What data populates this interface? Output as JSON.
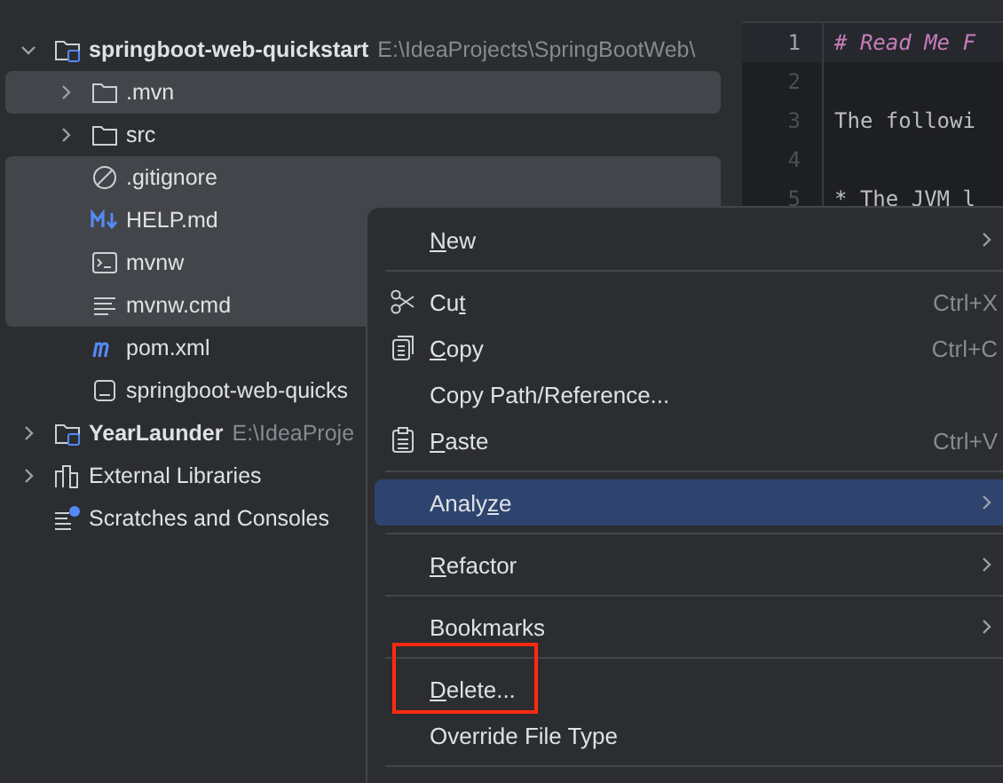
{
  "project_tree": [
    {
      "name": "springboot-web-quickstart",
      "path": "E:\\IdeaProjects\\SpringBootWeb\\",
      "kind": "module",
      "expanded": true,
      "selected": false,
      "children": [
        {
          "name": ".mvn",
          "kind": "folder",
          "expanded": false,
          "selected": true
        },
        {
          "name": "src",
          "kind": "folder",
          "expanded": false,
          "selected": false
        },
        {
          "name": ".gitignore",
          "kind": "ignore",
          "selected": true
        },
        {
          "name": "HELP.md",
          "kind": "markdown",
          "selected": true
        },
        {
          "name": "mvnw",
          "kind": "terminal",
          "selected": true
        },
        {
          "name": "mvnw.cmd",
          "kind": "text",
          "selected": true
        },
        {
          "name": "pom.xml",
          "kind": "maven",
          "selected": false
        },
        {
          "name": "springboot-web-quicks",
          "kind": "file",
          "selected": false
        }
      ]
    },
    {
      "name": "YearLaunder",
      "path": "E:\\IdeaProje",
      "kind": "module",
      "expanded": false,
      "selected": false
    },
    {
      "name": "External Libraries",
      "kind": "library",
      "expanded": false,
      "selected": false
    },
    {
      "name": "Scratches and Consoles",
      "kind": "scratches",
      "selected": false
    }
  ],
  "editor": {
    "lines": [
      {
        "number": "1",
        "text": "# Read Me F",
        "kind": "heading",
        "current": true
      },
      {
        "number": "2",
        "current": false
      },
      {
        "number": "3",
        "text": "The followi",
        "kind": "plain",
        "current": false
      },
      {
        "number": "4",
        "current": false
      },
      {
        "number": "5",
        "text": "* The JVM l",
        "kind": "bullet",
        "current": false
      }
    ]
  },
  "context_menu": {
    "items": [
      {
        "kind": "item",
        "label": {
          "key": "N",
          "after": "ew"
        },
        "submenu": true,
        "selected": false
      },
      {
        "kind": "separator"
      },
      {
        "kind": "cut",
        "label": {
          "before": "Cu",
          "key": "t"
        },
        "shortcut": "Ctrl+X",
        "selected": false
      },
      {
        "kind": "copy",
        "label": {
          "key": "C",
          "after": "opy"
        },
        "shortcut": "Ctrl+C",
        "selected": false
      },
      {
        "kind": "item",
        "label": {
          "before": "Copy Path/Reference..."
        },
        "selected": false
      },
      {
        "kind": "paste",
        "label": {
          "key": "P",
          "after": "aste"
        },
        "shortcut": "Ctrl+V",
        "selected": false
      },
      {
        "kind": "separator"
      },
      {
        "kind": "item",
        "label": {
          "before": "Analy",
          "key": "z",
          "after": "e"
        },
        "submenu": true,
        "selected": true
      },
      {
        "kind": "separator"
      },
      {
        "kind": "item",
        "label": {
          "key": "R",
          "after": "efactor"
        },
        "submenu": true,
        "selected": false
      },
      {
        "kind": "separator"
      },
      {
        "kind": "item",
        "label": {
          "before": "Bookmarks"
        },
        "submenu": true,
        "selected": false
      },
      {
        "kind": "separator"
      },
      {
        "kind": "item",
        "label": {
          "key": "D",
          "after": "elete..."
        },
        "annotated": true,
        "selected": false
      },
      {
        "kind": "item",
        "label": {
          "before": "Override File Type"
        },
        "selected": false
      },
      {
        "kind": "separator"
      }
    ]
  }
}
